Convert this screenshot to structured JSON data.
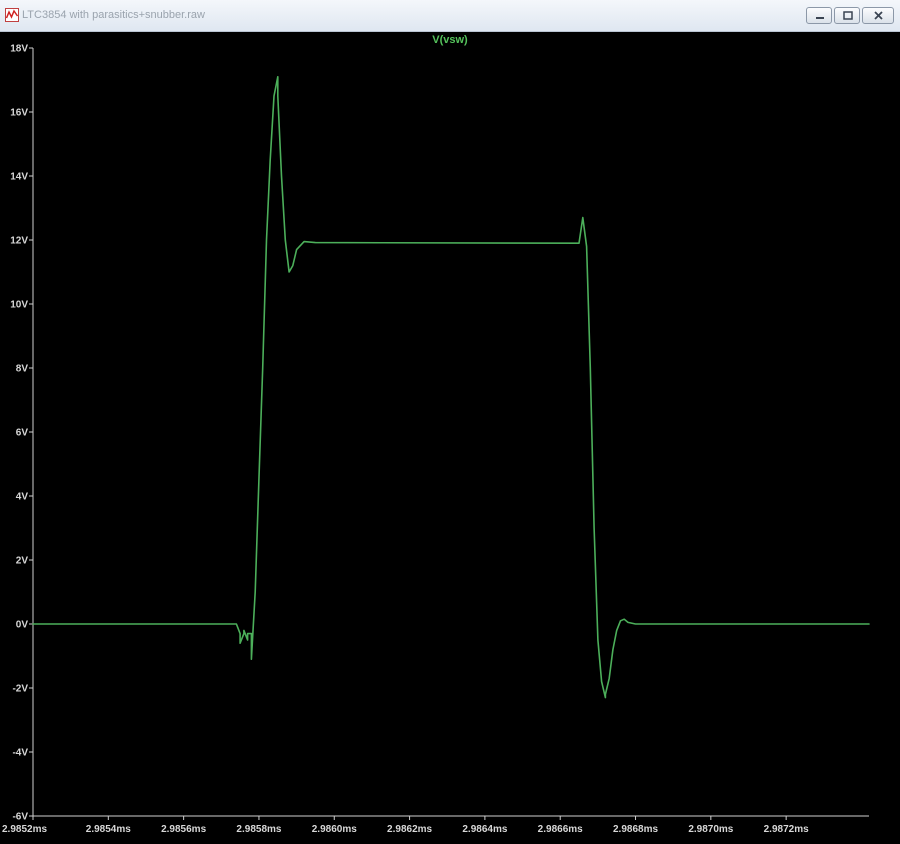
{
  "window": {
    "title": "LTC3854 with parasitics+snubber.raw"
  },
  "icons": {
    "app": "waveform-icon",
    "minimize": "minimize-icon",
    "maximize": "maximize-icon",
    "close": "close-icon"
  },
  "colors": {
    "background": "#000000",
    "trace": "#4caf5a",
    "trace_title": "#55c35c",
    "axis_frame": "#d0d0d0",
    "tick_text": "#d8d8d8"
  },
  "chart_data": {
    "type": "line",
    "title": "V(vsw)",
    "xlabel": "",
    "ylabel": "",
    "x_unit": "ms",
    "y_unit": "V",
    "xlim": [
      2.9852,
      2.98742
    ],
    "ylim": [
      -6,
      18
    ],
    "x_ticks": [
      {
        "value": 2.9852,
        "label": "2.9852ms"
      },
      {
        "value": 2.9854,
        "label": "2.9854ms"
      },
      {
        "value": 2.9856,
        "label": "2.9856ms"
      },
      {
        "value": 2.9858,
        "label": "2.9858ms"
      },
      {
        "value": 2.986,
        "label": "2.9860ms"
      },
      {
        "value": 2.9862,
        "label": "2.9862ms"
      },
      {
        "value": 2.9864,
        "label": "2.9864ms"
      },
      {
        "value": 2.9866,
        "label": "2.9866ms"
      },
      {
        "value": 2.9868,
        "label": "2.9868ms"
      },
      {
        "value": 2.987,
        "label": "2.9870ms"
      },
      {
        "value": 2.9872,
        "label": "2.9872ms"
      }
    ],
    "y_ticks": [
      {
        "value": 18,
        "label": "18V"
      },
      {
        "value": 16,
        "label": "16V"
      },
      {
        "value": 14,
        "label": "14V"
      },
      {
        "value": 12,
        "label": "12V"
      },
      {
        "value": 10,
        "label": "10V"
      },
      {
        "value": 8,
        "label": "8V"
      },
      {
        "value": 6,
        "label": "6V"
      },
      {
        "value": 4,
        "label": "4V"
      },
      {
        "value": 2,
        "label": "2V"
      },
      {
        "value": 0,
        "label": "0V"
      },
      {
        "value": -2,
        "label": "-2V"
      },
      {
        "value": -4,
        "label": "-4V"
      },
      {
        "value": -6,
        "label": "-6V"
      }
    ],
    "grid": false,
    "series": [
      {
        "points": [
          [
            2.9852,
            0.0
          ],
          [
            2.98574,
            0.0
          ],
          [
            2.98575,
            -0.3
          ],
          [
            2.98575,
            -0.6
          ],
          [
            2.98576,
            -0.3
          ],
          [
            2.98576,
            -0.2
          ],
          [
            2.98577,
            -0.5
          ],
          [
            2.98577,
            -0.3
          ],
          [
            2.98578,
            -0.3
          ],
          [
            2.98578,
            -1.1
          ],
          [
            2.98579,
            1.0
          ],
          [
            2.9858,
            4.5
          ],
          [
            2.98581,
            8.0
          ],
          [
            2.98582,
            12.0
          ],
          [
            2.98583,
            14.5
          ],
          [
            2.98584,
            16.5
          ],
          [
            2.98585,
            17.1
          ],
          [
            2.98585,
            16.5
          ],
          [
            2.98586,
            14.0
          ],
          [
            2.98587,
            12.0
          ],
          [
            2.98588,
            11.0
          ],
          [
            2.98589,
            11.2
          ],
          [
            2.9859,
            11.7
          ],
          [
            2.98592,
            11.95
          ],
          [
            2.98595,
            11.92
          ],
          [
            2.98665,
            11.9
          ],
          [
            2.98666,
            12.7
          ],
          [
            2.98667,
            11.8
          ],
          [
            2.98668,
            8.0
          ],
          [
            2.98669,
            3.0
          ],
          [
            2.9867,
            -0.5
          ],
          [
            2.98671,
            -1.8
          ],
          [
            2.98672,
            -2.3
          ],
          [
            2.98672,
            -2.2
          ],
          [
            2.98673,
            -1.7
          ],
          [
            2.98674,
            -0.8
          ],
          [
            2.98675,
            -0.2
          ],
          [
            2.98676,
            0.1
          ],
          [
            2.98677,
            0.15
          ],
          [
            2.98678,
            0.05
          ],
          [
            2.9868,
            0.0
          ],
          [
            2.98742,
            0.0
          ]
        ]
      }
    ]
  }
}
